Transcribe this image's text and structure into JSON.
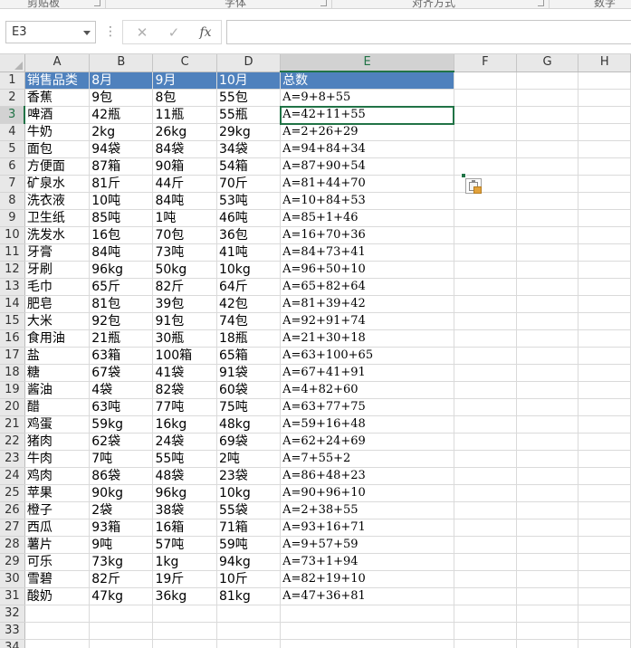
{
  "ribbon": {
    "groups": [
      "剪贴板",
      "字体",
      "对齐方式",
      "数字"
    ]
  },
  "formula_bar": {
    "name_box": "E3",
    "dots": "⋮",
    "cancel_icon": "✕",
    "enter_icon": "✓",
    "fx_label": "fx",
    "formula": ""
  },
  "sheet": {
    "columns": [
      "A",
      "B",
      "C",
      "D",
      "E",
      "F",
      "G",
      "H"
    ],
    "selected_cell": "E3",
    "header_fill": "#4f81bd",
    "rows": [
      [
        "销售品类",
        "8月",
        "9月",
        "10月",
        "总数"
      ],
      [
        "香蕉",
        "9包",
        "8包",
        "55包",
        "A=9+8+55"
      ],
      [
        "啤酒",
        "42瓶",
        "11瓶",
        "55瓶",
        "A=42+11+55"
      ],
      [
        "牛奶",
        "2kg",
        "26kg",
        "29kg",
        "A=2+26+29"
      ],
      [
        "面包",
        "94袋",
        "84袋",
        "34袋",
        "A=94+84+34"
      ],
      [
        "方便面",
        "87箱",
        "90箱",
        "54箱",
        "A=87+90+54"
      ],
      [
        "矿泉水",
        "81斤",
        "44斤",
        "70斤",
        "A=81+44+70"
      ],
      [
        "洗衣液",
        "10吨",
        "84吨",
        "53吨",
        "A=10+84+53"
      ],
      [
        "卫生纸",
        "85吨",
        "1吨",
        "46吨",
        "A=85+1+46"
      ],
      [
        "洗发水",
        "16包",
        "70包",
        "36包",
        "A=16+70+36"
      ],
      [
        "牙膏",
        "84吨",
        "73吨",
        "41吨",
        "A=84+73+41"
      ],
      [
        "牙刷",
        "96kg",
        "50kg",
        "10kg",
        "A=96+50+10"
      ],
      [
        "毛巾",
        "65斤",
        "82斤",
        "64斤",
        "A=65+82+64"
      ],
      [
        "肥皂",
        "81包",
        "39包",
        "42包",
        "A=81+39+42"
      ],
      [
        "大米",
        "92包",
        "91包",
        "74包",
        "A=92+91+74"
      ],
      [
        "食用油",
        "21瓶",
        "30瓶",
        "18瓶",
        "A=21+30+18"
      ],
      [
        "盐",
        "63箱",
        "100箱",
        "65箱",
        "A=63+100+65"
      ],
      [
        "糖",
        "67袋",
        "41袋",
        "91袋",
        "A=67+41+91"
      ],
      [
        "酱油",
        "4袋",
        "82袋",
        "60袋",
        "A=4+82+60"
      ],
      [
        "醋",
        "63吨",
        "77吨",
        "75吨",
        "A=63+77+75"
      ],
      [
        "鸡蛋",
        "59kg",
        "16kg",
        "48kg",
        "A=59+16+48"
      ],
      [
        "猪肉",
        "62袋",
        "24袋",
        "69袋",
        "A=62+24+69"
      ],
      [
        "牛肉",
        "7吨",
        "55吨",
        "2吨",
        "A=7+55+2"
      ],
      [
        "鸡肉",
        "86袋",
        "48袋",
        "23袋",
        "A=86+48+23"
      ],
      [
        "苹果",
        "90kg",
        "96kg",
        "10kg",
        "A=90+96+10"
      ],
      [
        "橙子",
        "2袋",
        "38袋",
        "55袋",
        "A=2+38+55"
      ],
      [
        "西瓜",
        "93箱",
        "16箱",
        "71箱",
        "A=93+16+71"
      ],
      [
        "薯片",
        "9吨",
        "57吨",
        "59吨",
        "A=9+57+59"
      ],
      [
        "可乐",
        "73kg",
        "1kg",
        "94kg",
        "A=73+1+94"
      ],
      [
        "雪碧",
        "82斤",
        "19斤",
        "10斤",
        "A=82+19+10"
      ],
      [
        "酸奶",
        "47kg",
        "36kg",
        "81kg",
        "A=47+36+81"
      ],
      [
        "",
        "",
        "",
        "",
        ""
      ],
      [
        "",
        "",
        "",
        "",
        ""
      ],
      [
        "",
        "",
        "",
        "",
        ""
      ]
    ]
  }
}
